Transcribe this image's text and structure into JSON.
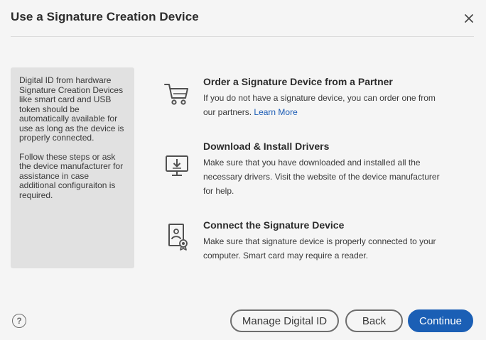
{
  "dialog": {
    "title": "Use a Signature Creation Device",
    "close_icon": "close-icon"
  },
  "sidebar": {
    "paragraphs": [
      "Digital ID from hardware Signature Creation Devices like smart card and USB token should be automatically available for use as long as the device is properly connected.",
      "Follow these steps or ask the device manufacturer for assistance in case additional configuraiton is required."
    ]
  },
  "steps": [
    {
      "icon": "shopping-cart-icon",
      "title": "Order a Signature Device from a Partner",
      "text": "If you do not have a signature device, you can order one from our partners.",
      "link": "Learn More"
    },
    {
      "icon": "monitor-download-icon",
      "title": "Download & Install Drivers",
      "text": "Make sure that you have downloaded and installed all the necessary drivers. Visit the website of the device manufacturer for help."
    },
    {
      "icon": "certificate-device-icon",
      "title": "Connect the Signature Device",
      "text": "Make sure that signature device is properly connected to your computer. Smart card may require a reader."
    }
  ],
  "footer": {
    "help_label": "?",
    "manage_label": "Manage Digital ID",
    "back_label": "Back",
    "continue_label": "Continue"
  },
  "colors": {
    "background": "#f5f5f5",
    "sidebar_bg": "#e1e1e1",
    "accent": "#1b5fb5",
    "link": "#1a5bb5"
  }
}
